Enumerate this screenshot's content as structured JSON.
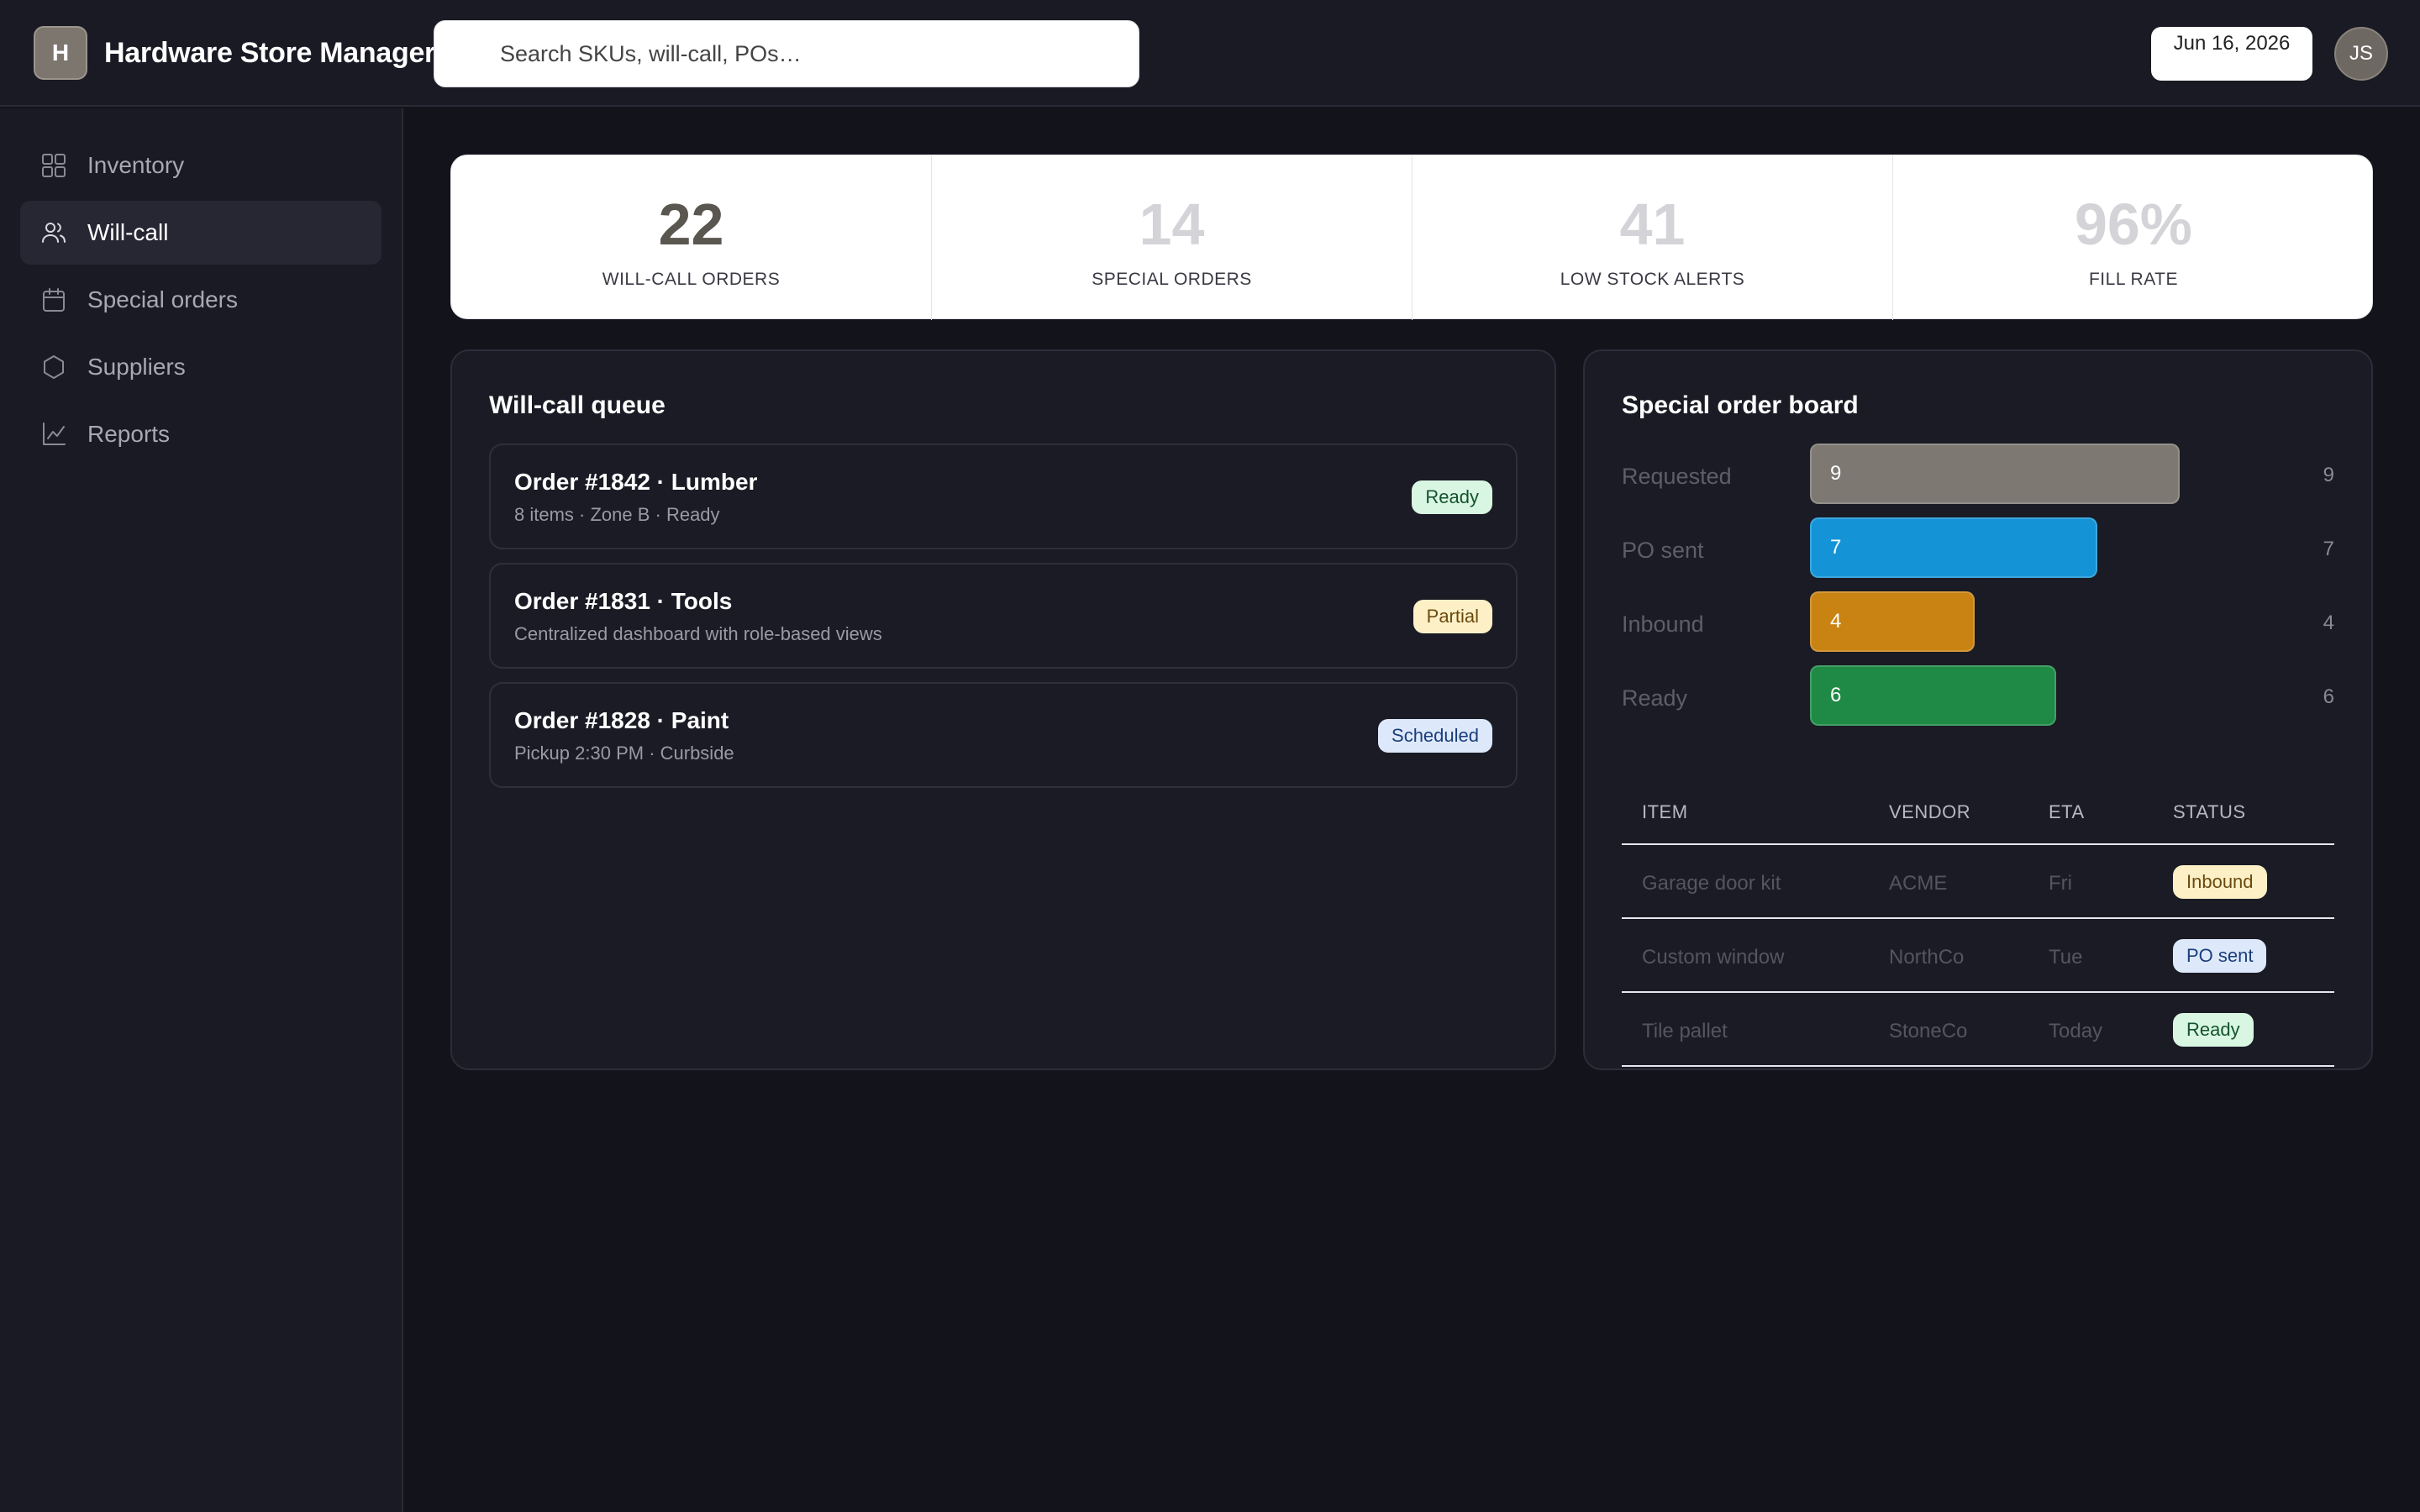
{
  "header": {
    "logo_letter": "H",
    "app_title": "Hardware Store Manager",
    "search_placeholder": "Search SKUs, will-call, POs…",
    "date": "Jun 16, 2026",
    "avatar_initials": "JS"
  },
  "sidebar": {
    "items": [
      {
        "label": "Inventory",
        "icon": "grid-icon",
        "active": false
      },
      {
        "label": "Will-call",
        "icon": "users-icon",
        "active": true
      },
      {
        "label": "Special orders",
        "icon": "calendar-icon",
        "active": false
      },
      {
        "label": "Suppliers",
        "icon": "hexagon-icon",
        "active": false
      },
      {
        "label": "Reports",
        "icon": "line-chart-icon",
        "active": false
      }
    ]
  },
  "kpis": [
    {
      "value": "22",
      "label": "WILL-CALL ORDERS",
      "color": "#5a5650"
    },
    {
      "value": "14",
      "label": "SPECIAL ORDERS",
      "color": "#d4d4d8"
    },
    {
      "value": "41",
      "label": "LOW STOCK ALERTS",
      "color": "#d4d4d8"
    },
    {
      "value": "96%",
      "label": "FILL RATE",
      "color": "#d4d4d8"
    }
  ],
  "will_call": {
    "title": "Will-call queue",
    "orders": [
      {
        "title": "Order #1842 · Lumber",
        "sub": "8 items · Zone B · Ready",
        "status": "Ready"
      },
      {
        "title": "Order #1831 · Tools",
        "sub": "Centralized dashboard with role-based views",
        "status": "Partial"
      },
      {
        "title": "Order #1828 · Paint",
        "sub": "Pickup 2:30 PM · Curbside",
        "status": "Scheduled"
      }
    ]
  },
  "special_board": {
    "title": "Special order board",
    "bars": [
      {
        "label": "Requested",
        "value": 9,
        "count": "9",
        "color": "#7d7872"
      },
      {
        "label": "PO sent",
        "value": 7,
        "count": "7",
        "color": "#1494d6"
      },
      {
        "label": "Inbound",
        "value": 4,
        "count": "4",
        "color": "#c98313"
      },
      {
        "label": "Ready",
        "value": 6,
        "count": "6",
        "color": "#1e8a45"
      }
    ],
    "table": {
      "headers": [
        "ITEM",
        "VENDOR",
        "ETA",
        "STATUS"
      ],
      "rows": [
        {
          "item": "Garage door kit",
          "vendor": "ACME",
          "eta": "Fri",
          "status": "Inbound"
        },
        {
          "item": "Custom window",
          "vendor": "NorthCo",
          "eta": "Tue",
          "status": "PO sent"
        },
        {
          "item": "Tile pallet",
          "vendor": "StoneCo",
          "eta": "Today",
          "status": "Ready"
        }
      ]
    }
  }
}
